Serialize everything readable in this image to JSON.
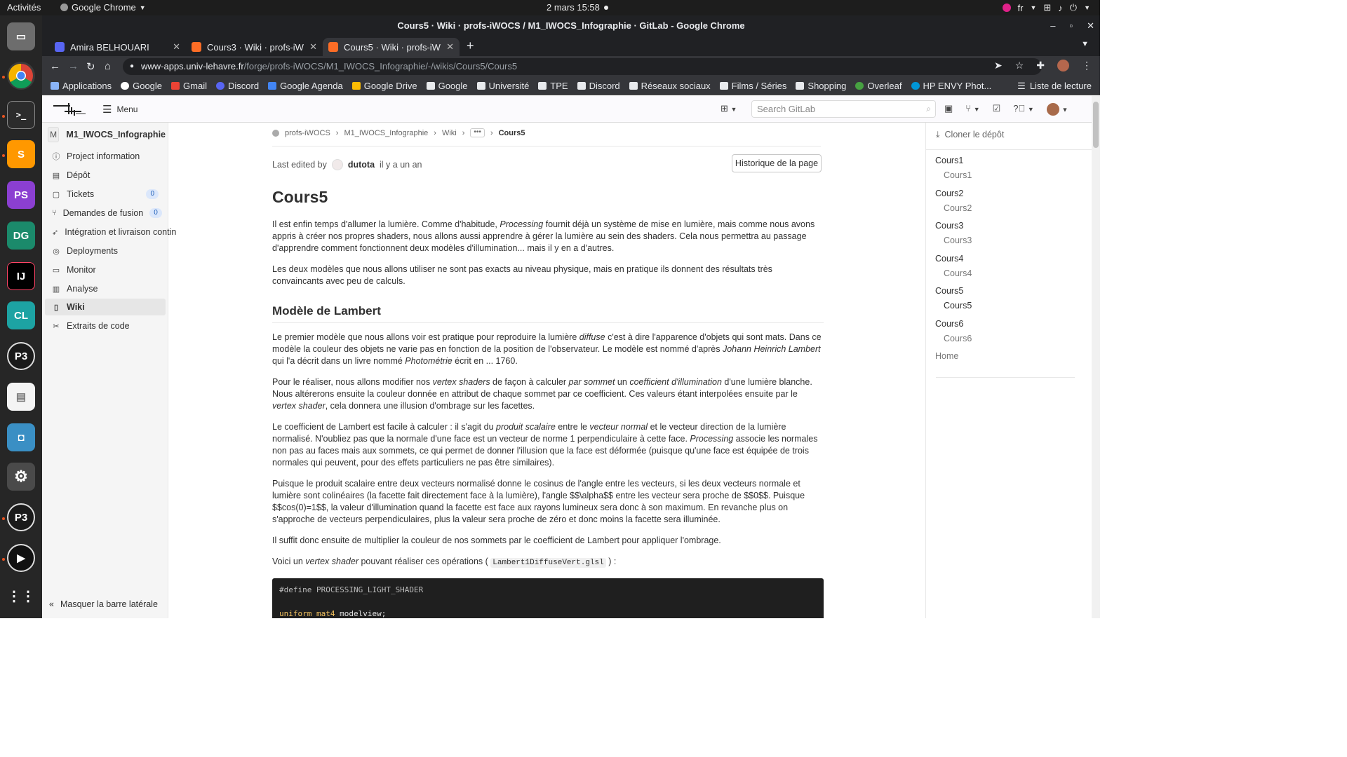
{
  "os_bar": {
    "activities": "Activités",
    "app_menu": "Google Chrome",
    "clock": "2 mars  15:58",
    "lang": "fr"
  },
  "window": {
    "title": "Cours5 · Wiki · profs-iWOCS / M1_IWOCS_Infographie · GitLab - Google Chrome"
  },
  "tabs": [
    {
      "label": "Amira BELHOUARI",
      "color": "#5865f2"
    },
    {
      "label": "Cours3 · Wiki · profs-iWOC",
      "color": "#fc6d26"
    },
    {
      "label": "Cours5 · Wiki · profs-iWOC",
      "color": "#fc6d26"
    }
  ],
  "url": {
    "host": "www-apps.univ-lehavre.fr",
    "path": "/forge/profs-iWOCS/M1_IWOCS_Infographie/-/wikis/Cours5/Cours5"
  },
  "bookmarks": [
    {
      "label": "Applications",
      "color": "#8ab4f8"
    },
    {
      "label": "Google",
      "color": "#ffffff"
    },
    {
      "label": "Gmail",
      "color": "#ea4335"
    },
    {
      "label": "Discord",
      "color": "#5865f2"
    },
    {
      "label": "Google Agenda",
      "color": "#4285f4"
    },
    {
      "label": "Google Drive",
      "color": "#fbbc04"
    },
    {
      "label": "Google",
      "color": "#e8eaed"
    },
    {
      "label": "Université",
      "color": "#e8eaed"
    },
    {
      "label": "TPE",
      "color": "#e8eaed"
    },
    {
      "label": "Discord",
      "color": "#e8eaed"
    },
    {
      "label": "Réseaux sociaux",
      "color": "#e8eaed"
    },
    {
      "label": "Films / Séries",
      "color": "#e8eaed"
    },
    {
      "label": "Shopping",
      "color": "#e8eaed"
    },
    {
      "label": "Overleaf",
      "color": "#47a141"
    },
    {
      "label": "HP ENVY Phot...",
      "color": "#0096d6"
    }
  ],
  "reading_list": "Liste de lecture",
  "gitlab": {
    "menu_label": "Menu",
    "search_placeholder": "Search GitLab",
    "project_initial": "M",
    "project_name": "M1_IWOCS_Infographie",
    "nav": [
      {
        "label": "Project information",
        "icon": "info-icon"
      },
      {
        "label": "Dépôt",
        "icon": "document-icon"
      },
      {
        "label": "Tickets",
        "icon": "issues-icon",
        "count": "0"
      },
      {
        "label": "Demandes de fusion",
        "icon": "merge-request-icon",
        "count": "0"
      },
      {
        "label": "Intégration et livraison contin",
        "icon": "rocket-icon"
      },
      {
        "label": "Deployments",
        "icon": "deployments-icon"
      },
      {
        "label": "Monitor",
        "icon": "monitor-icon"
      },
      {
        "label": "Analyse",
        "icon": "chart-icon"
      },
      {
        "label": "Wiki",
        "icon": "book-icon"
      },
      {
        "label": "Extraits de code",
        "icon": "snippet-icon"
      }
    ],
    "collapse_label": "Masquer la barre latérale",
    "breadcrumbs": [
      "profs-iWOCS",
      "M1_IWOCS_Infographie",
      "Wiki",
      "•••",
      "Cours5"
    ],
    "last_edited_prefix": "Last edited by",
    "last_edited_user": "dutota",
    "last_edited_time": "il y a un an",
    "history_button": "Historique de la page",
    "page_title": "Cours5",
    "clone_label": "Cloner le dépôt",
    "wiki_pages": [
      {
        "label": "Cours1",
        "child": "Cours1"
      },
      {
        "label": "Cours2",
        "child": "Cours2"
      },
      {
        "label": "Cours3",
        "child": "Cours3"
      },
      {
        "label": "Cours4",
        "child": "Cours4"
      },
      {
        "label": "Cours5",
        "child": "Cours5"
      },
      {
        "label": "Cours6",
        "child": "Cours6"
      }
    ],
    "wiki_home": "Home"
  },
  "article": {
    "p1": [
      {
        "t": "Il est enfin temps d'allumer la lumière. Comme d'habitude, "
      },
      {
        "t": "Processing",
        "i": true
      },
      {
        "t": " fournit déjà un système de mise en lumière, mais comme nous avons appris à créer nos propres shaders, nous allons aussi apprendre à gérer la lumière au sein des shaders. Cela nous permettra au passage d'apprendre comment fonctionnent deux modèles d'illumination... mais il y en a d'autres."
      }
    ],
    "p2": [
      {
        "t": "Les deux modèles que nous allons utiliser ne sont pas exacts au niveau physique, mais en pratique ils donnent des résultats très convaincants avec peu de calculs."
      }
    ],
    "h2": "Modèle de Lambert",
    "p3": [
      {
        "t": "Le premier modèle que nous allons voir est pratique pour reproduire la lumière "
      },
      {
        "t": "diffuse",
        "i": true
      },
      {
        "t": " c'est à dire l'apparence d'objets qui sont mats. Dans ce modèle la couleur des objets ne varie pas en fonction de la position de l'observateur. Le modèle est nommé d'après "
      },
      {
        "t": "Johann Heinrich Lambert",
        "i": true
      },
      {
        "t": " qui l'a décrit dans un livre nommé "
      },
      {
        "t": "Photométrie",
        "i": true
      },
      {
        "t": " écrit en ... 1760."
      }
    ],
    "p4": [
      {
        "t": "Pour le réaliser, nous allons modifier nos "
      },
      {
        "t": "vertex shaders",
        "i": true
      },
      {
        "t": " de façon à calculer "
      },
      {
        "t": "par sommet",
        "i": true
      },
      {
        "t": " un "
      },
      {
        "t": "coefficient d'illumination",
        "i": true
      },
      {
        "t": " d'une lumière blanche. Nous altérerons ensuite la couleur donnée en attribut de chaque sommet par ce coefficient. Ces valeurs étant interpolées ensuite par le "
      },
      {
        "t": "vertex shader",
        "i": true
      },
      {
        "t": ", cela donnera une illusion d'ombrage sur les facettes."
      }
    ],
    "p5": [
      {
        "t": "Le coefficient de Lambert est facile à calculer : il s'agit du "
      },
      {
        "t": "produit scalaire",
        "i": true
      },
      {
        "t": " entre le "
      },
      {
        "t": "vecteur normal",
        "i": true
      },
      {
        "t": " et le vecteur direction de la lumière normalisé. N'oubliez pas que la normale d'une face est un vecteur de norme 1 perpendiculaire à cette face. "
      },
      {
        "t": "Processing",
        "i": true
      },
      {
        "t": " associe les normales non pas au faces mais aux sommets, ce qui permet de donner l'illusion que la face est déformée (puisque qu'une face est équipée de trois normales qui peuvent, pour des effets particuliers ne pas être similaires)."
      }
    ],
    "p6": [
      {
        "t": "Puisque le produit scalaire entre deux vecteurs normalisé donne le cosinus de l'angle entre les vecteurs, si les deux vecteurs normale et lumière sont colinéaires (la facette fait directement face à la lumière), l'angle $$\\alpha$$ entre les vecteur sera proche de $$0$$. Puisque $$cos(0)=1$$, la valeur d'illumination quand la facette est face aux rayons lumineux sera donc à son maximum. En revanche plus on s'approche de vecteurs perpendiculaires, plus la valeur sera proche de zéro et donc moins la facette sera illuminée."
      }
    ],
    "p7": [
      {
        "t": "Il suffit donc ensuite de multiplier la couleur de nos sommets par le coefficient de Lambert pour appliquer l'ombrage."
      }
    ],
    "p8": [
      {
        "t": "Voici un "
      },
      {
        "t": "vertex shader",
        "i": true
      },
      {
        "t": " pouvant réaliser ces opérations ( "
      },
      {
        "t": "Lambert1DiffuseVert.glsl",
        "c": true
      },
      {
        "t": " ) :"
      }
    ],
    "code_line1": "#define PROCESSING_LIGHT_SHADER",
    "code_line2_kw1": "uniform",
    "code_line2_kw2": "mat4",
    "code_line2_rest": " modelview;"
  }
}
